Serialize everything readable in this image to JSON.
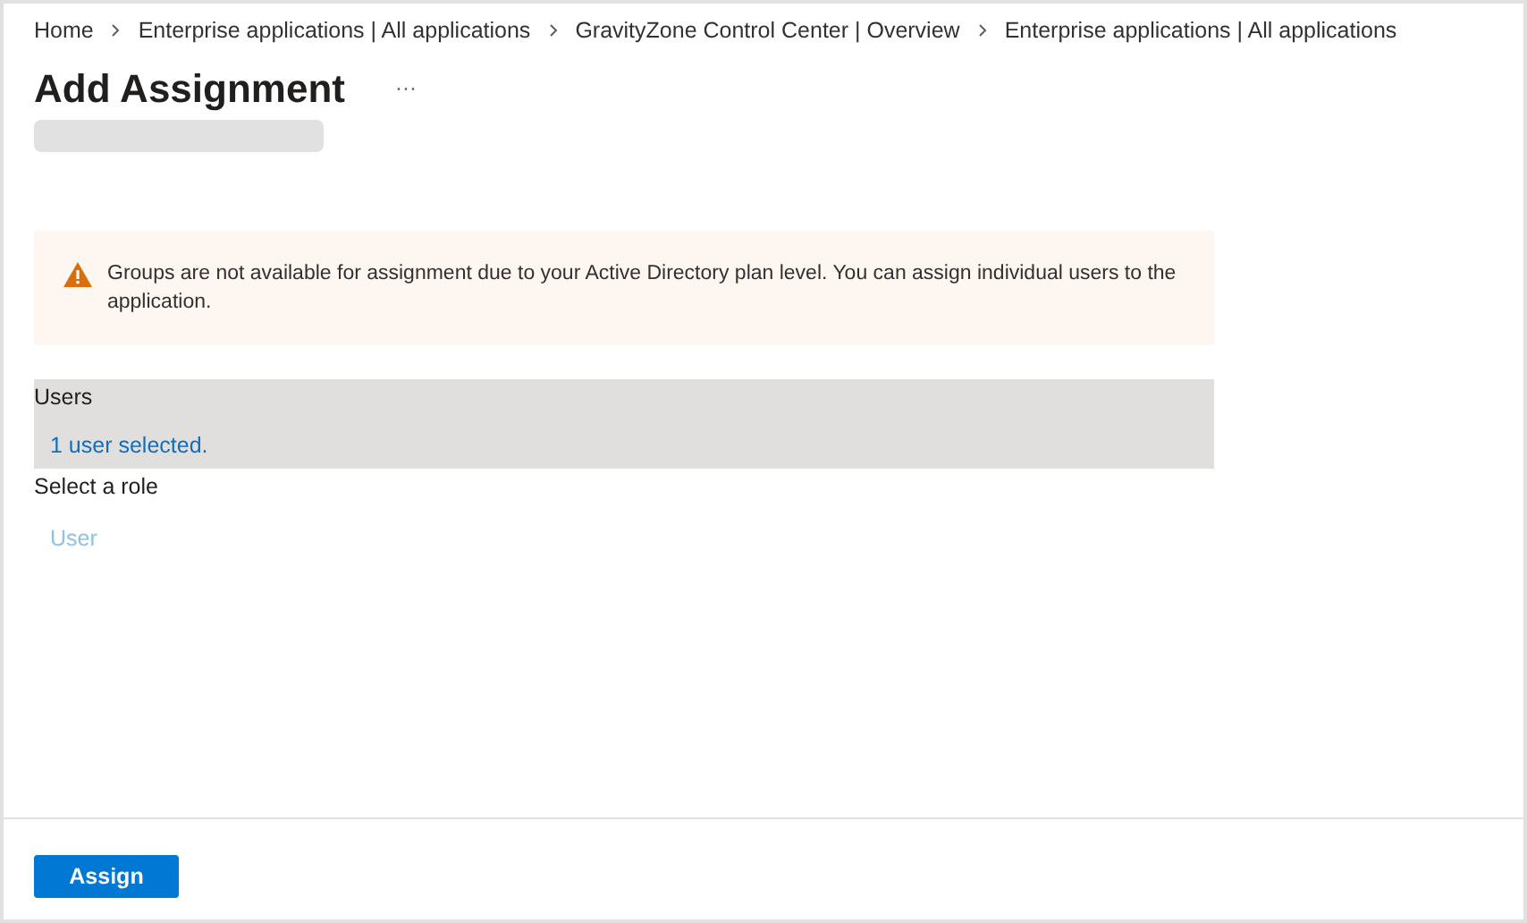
{
  "breadcrumb": [
    "Home",
    "Enterprise applications | All applications",
    "GravityZone Control Center | Overview",
    "Enterprise applications | All applications"
  ],
  "title": "Add Assignment",
  "more_menu": "···",
  "warning": {
    "text": "Groups are not available for assignment due to your Active Directory plan level. You can assign individual users to the application."
  },
  "users": {
    "label": "Users",
    "value": "1 user selected."
  },
  "role": {
    "label": "Select a role",
    "value": "User"
  },
  "buttons": [
    "Assign"
  ]
}
